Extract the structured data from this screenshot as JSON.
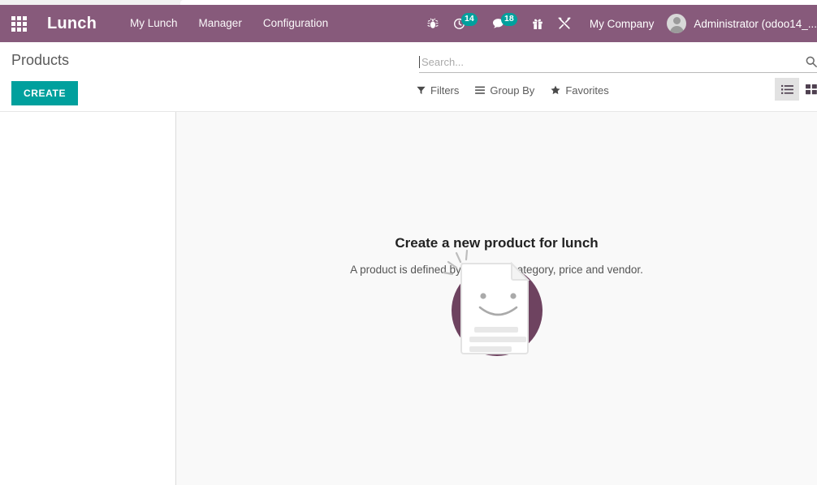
{
  "theme": {
    "navbar_purple": "#875A7B",
    "accent_teal": "#00A09D",
    "illustration_circle": "#6E4360",
    "content_bg": "#F9F9F9"
  },
  "navbar": {
    "apps_icon": "apps-grid-icon",
    "brand": "Lunch",
    "menu_items": [
      {
        "label": "My Lunch",
        "name": "menu-my-lunch"
      },
      {
        "label": "Manager",
        "name": "menu-manager"
      },
      {
        "label": "Configuration",
        "name": "menu-configuration"
      }
    ],
    "systray": [
      {
        "name": "bug-icon",
        "icon": "bug",
        "badge": null
      },
      {
        "name": "activities-icon",
        "icon": "clock",
        "badge": "14"
      },
      {
        "name": "messages-icon",
        "icon": "chat",
        "badge": "18"
      },
      {
        "name": "gift-icon",
        "icon": "gift",
        "badge": null
      },
      {
        "name": "tools-icon",
        "icon": "tools",
        "badge": null
      }
    ],
    "activities_badge": "14",
    "messages_badge": "18",
    "company": "My Company",
    "user_name": "Administrator (odoo14_..."
  },
  "control_panel": {
    "title": "Products",
    "create_label": "CREATE",
    "search": {
      "placeholder": "Search...",
      "value": "",
      "icon": "search-icon"
    },
    "buttons": [
      {
        "label": "Filters",
        "icon": "filter-icon",
        "name": "filters-button"
      },
      {
        "label": "Group By",
        "icon": "bars-icon",
        "name": "group-by-button"
      },
      {
        "label": "Favorites",
        "icon": "star-icon",
        "name": "favorites-button"
      }
    ],
    "views": [
      {
        "name": "view-switch-list",
        "icon": "list-icon",
        "active": true
      },
      {
        "name": "view-switch-kanban",
        "icon": "kanban-icon",
        "active": false
      }
    ]
  },
  "empty_state": {
    "illustration": "smiling-document-illustration",
    "title": "Create a new product for lunch",
    "subtitle": "A product is defined by its name, category, price and vendor."
  }
}
